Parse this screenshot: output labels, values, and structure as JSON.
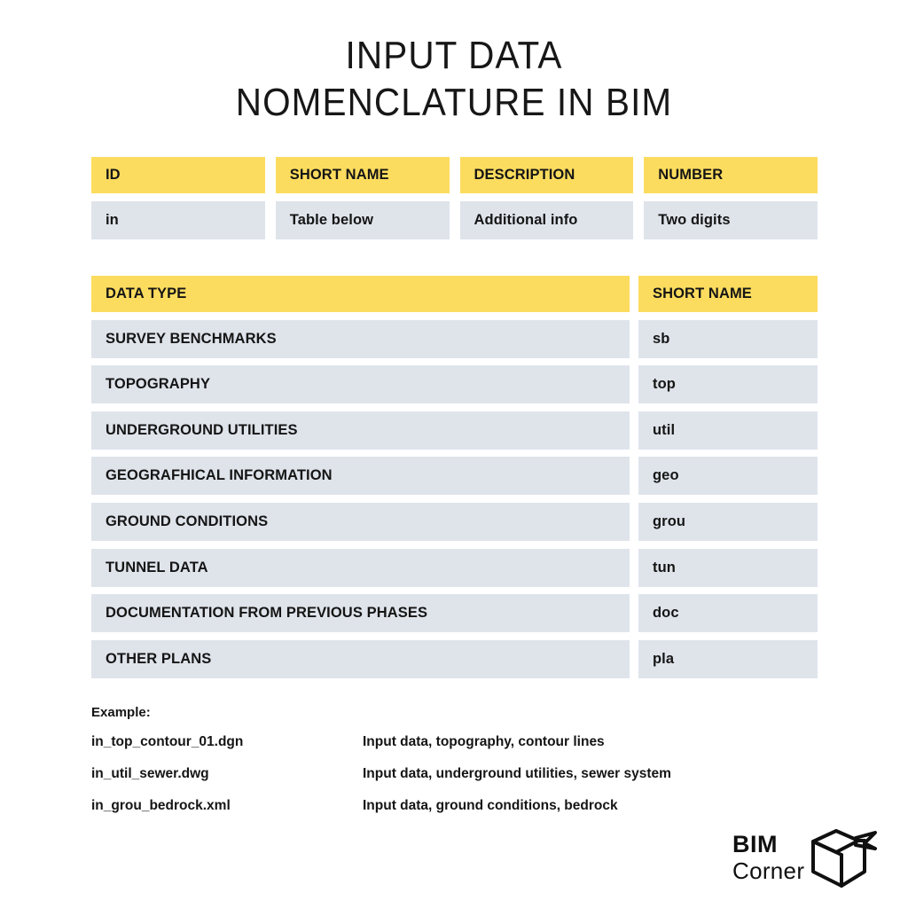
{
  "title": {
    "line1": "INPUT DATA",
    "line2": "NOMENCLATURE IN BIM"
  },
  "colors": {
    "header_yellow": "#FCDC5E",
    "cell_gray": "#DFE4EB",
    "text": "#151515",
    "background": "#FFFFFF"
  },
  "naming_table": {
    "headers": [
      "ID",
      "SHORT NAME",
      "DESCRIPTION",
      "NUMBER"
    ],
    "values": [
      "in",
      "Table below",
      "Additional info",
      "Two digits"
    ]
  },
  "data_type_table": {
    "headers": [
      "DATA TYPE",
      "SHORT NAME"
    ],
    "rows": [
      {
        "data_type": "SURVEY BENCHMARKS",
        "short_name": "sb"
      },
      {
        "data_type": "TOPOGRAPHY",
        "short_name": "top"
      },
      {
        "data_type": "UNDERGROUND UTILITIES",
        "short_name": "util"
      },
      {
        "data_type": "GEOGRAFHICAL INFORMATION",
        "short_name": "geo"
      },
      {
        "data_type": "GROUND CONDITIONS",
        "short_name": "grou"
      },
      {
        "data_type": "TUNNEL DATA",
        "short_name": "tun"
      },
      {
        "data_type": "DOCUMENTATION FROM PREVIOUS PHASES",
        "short_name": "doc"
      },
      {
        "data_type": "OTHER PLANS",
        "short_name": "pla"
      }
    ]
  },
  "example": {
    "heading": "Example:",
    "rows": [
      {
        "file": "in_top_contour_01.dgn",
        "description": "Input data, topography, contour lines"
      },
      {
        "file": "in_util_sewer.dwg",
        "description": "Input data, underground utilities, sewer system"
      },
      {
        "file": "in_grou_bedrock.xml",
        "description": "Input data, ground conditions, bedrock"
      }
    ]
  },
  "logo": {
    "primary": "BIM",
    "secondary": "Corner",
    "icon": "open-box-cube-icon"
  }
}
